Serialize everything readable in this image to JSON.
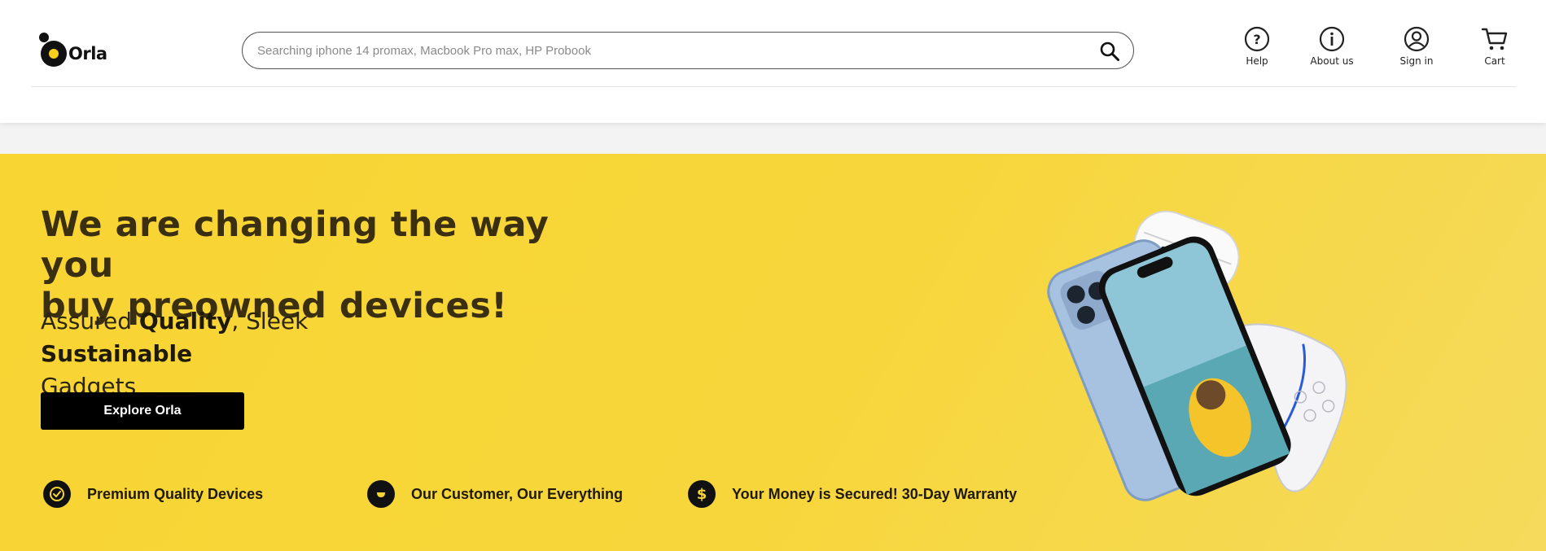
{
  "header": {
    "logo_text": "Orla",
    "search": {
      "placeholder": "Searching iphone 14 promax, Macbook Pro max, HP Probook",
      "value": ""
    },
    "nav": [
      {
        "label": "Help",
        "icon": "help-icon"
      },
      {
        "label": "About us",
        "icon": "info-icon"
      },
      {
        "label": "Sign in",
        "icon": "user-icon"
      },
      {
        "label": "Cart",
        "icon": "cart-icon"
      }
    ]
  },
  "hero": {
    "headline_line1": "We are changing the way you",
    "headline_line2": "buy preowned devices!",
    "tagline": {
      "part1": "Assured ",
      "bold1": "Quality",
      "part2": ", Sleek ",
      "bold2": "Sustainable",
      "part3": "Gadgets"
    },
    "cta_label": "Explore Orla",
    "features": [
      {
        "text": "Premium Quality Devices",
        "icon": "verified-badge-icon"
      },
      {
        "text": "Our Customer, Our Everything",
        "icon": "chat-bubble-icon"
      },
      {
        "text": "Your Money is Secured! 30-Day Warranty",
        "icon": "dollar-icon"
      }
    ],
    "image_subjects": [
      "iphone",
      "airpods-pro",
      "ps5-controller"
    ]
  },
  "colors": {
    "brand_yellow": "#f8d532",
    "text_dark": "#3a2f10",
    "button_bg": "#000000",
    "button_text": "#ffffff"
  }
}
